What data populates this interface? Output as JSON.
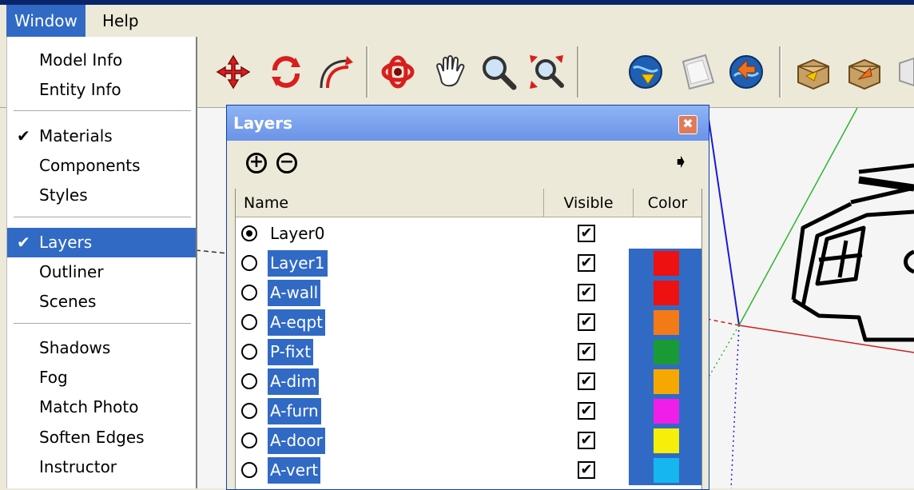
{
  "menubar": {
    "window": "Window",
    "help": "Help"
  },
  "window_menu": {
    "items": [
      {
        "label": "Model Info",
        "checked": false
      },
      {
        "label": "Entity Info",
        "checked": false
      },
      {
        "label": "Materials",
        "checked": true
      },
      {
        "label": "Components",
        "checked": false
      },
      {
        "label": "Styles",
        "checked": false
      },
      {
        "label": "Layers",
        "checked": true,
        "selected": true
      },
      {
        "label": "Outliner",
        "checked": false
      },
      {
        "label": "Scenes",
        "checked": false
      },
      {
        "label": "Shadows",
        "checked": false
      },
      {
        "label": "Fog",
        "checked": false
      },
      {
        "label": "Match Photo",
        "checked": false
      },
      {
        "label": "Soften Edges",
        "checked": false
      },
      {
        "label": "Instructor",
        "checked": false
      }
    ],
    "check_glyph": "✔"
  },
  "layers": {
    "title": "Layers",
    "close_glyph": "✖",
    "add_glyph": "+",
    "remove_glyph": "−",
    "details_glyph": "➧",
    "columns": {
      "name": "Name",
      "visible": "Visible",
      "color": "Color"
    },
    "check_glyph": "✔",
    "rows": [
      {
        "name": "Layer0",
        "active": true,
        "selected": false,
        "visible": true,
        "color": ""
      },
      {
        "name": "Layer1",
        "active": false,
        "selected": true,
        "visible": true,
        "color": "#ee1111"
      },
      {
        "name": "A-wall",
        "active": false,
        "selected": true,
        "visible": true,
        "color": "#ee1111"
      },
      {
        "name": "A-eqpt",
        "active": false,
        "selected": true,
        "visible": true,
        "color": "#f47a17"
      },
      {
        "name": "P-fixt",
        "active": false,
        "selected": true,
        "visible": true,
        "color": "#1a9a35"
      },
      {
        "name": "A-dim",
        "active": false,
        "selected": true,
        "visible": true,
        "color": "#f7a800"
      },
      {
        "name": "A-furn",
        "active": false,
        "selected": true,
        "visible": true,
        "color": "#f01ee8"
      },
      {
        "name": "A-door",
        "active": false,
        "selected": true,
        "visible": true,
        "color": "#f6ef0a"
      },
      {
        "name": "A-vert",
        "active": false,
        "selected": true,
        "visible": true,
        "color": "#16b6f0"
      }
    ]
  },
  "toolbar": {
    "icons": [
      "orbit-icon",
      "move-arrows-icon",
      "rotate-icon",
      "offset-icon",
      "follow-me-icon",
      "pan-icon",
      "zoom-icon",
      "zoom-extents-icon",
      "get-models-icon",
      "section-plane-icon",
      "share-model-icon",
      "component-box-icon",
      "share-component-icon"
    ]
  }
}
